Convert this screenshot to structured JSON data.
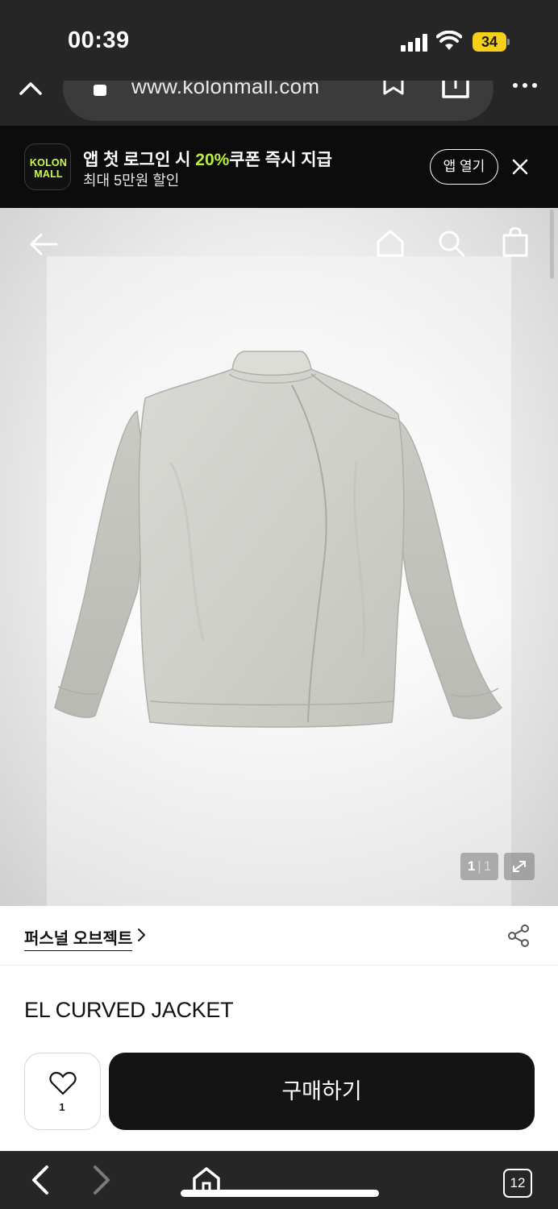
{
  "status_bar": {
    "time": "00:39",
    "battery_level": "34"
  },
  "browser": {
    "url": "www.kolonmall.com",
    "tab_count": "12"
  },
  "promo_banner": {
    "logo_line1": "KOLON",
    "logo_line2": "MALL",
    "headline_prefix": "앱 첫 로그인 시 ",
    "headline_highlight": "20%",
    "headline_suffix": "쿠폰 즉시 지급",
    "subtext": "최대 5만원 할인",
    "open_app_label": "앱 열기",
    "highlight_color": "#b8f03a"
  },
  "product": {
    "image_page_current": "1",
    "image_page_total": "1",
    "brand": "퍼스널 오브젝트",
    "title": "EL CURVED JACKET",
    "wish_count": "1",
    "buy_label": "구매하기"
  },
  "icons": {
    "hero": [
      "back-arrow-icon",
      "home-icon",
      "search-icon",
      "shopping-bag-icon"
    ],
    "browser": [
      "collapse-chevron-icon",
      "lock-icon",
      "bookmark-icon",
      "share-icon",
      "more-icon",
      "chevron-left-icon",
      "chevron-right-icon",
      "home-icon",
      "tabs-icon"
    ]
  }
}
